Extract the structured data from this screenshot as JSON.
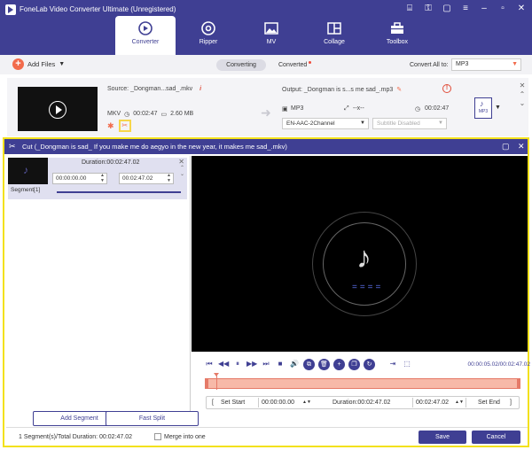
{
  "app": {
    "title": "FoneLab Video Converter Ultimate (Unregistered)",
    "window_icons": [
      "gift-icon",
      "key-icon",
      "chat-icon",
      "menu-icon",
      "minimize-icon",
      "maximize-icon",
      "close-icon"
    ],
    "window_glyphs": [
      "⌸",
      "⚿",
      "▢",
      "≡",
      "–",
      "▫",
      "✕"
    ]
  },
  "tabs": [
    {
      "label": "Converter",
      "icon": "converter-icon",
      "active": true
    },
    {
      "label": "Ripper",
      "icon": "disc-icon",
      "active": false
    },
    {
      "label": "MV",
      "icon": "image-icon",
      "active": false
    },
    {
      "label": "Collage",
      "icon": "collage-icon",
      "active": false
    },
    {
      "label": "Toolbox",
      "icon": "toolbox-icon",
      "active": false
    }
  ],
  "toolbar": {
    "add_files": "Add Files",
    "converting": "Converting",
    "converted": "Converted",
    "convert_all_label": "Convert All to:",
    "convert_all_value": "MP3"
  },
  "file": {
    "source": "Source: _Dongman...sad_.mkv",
    "container": "MKV",
    "duration": "00:02:47",
    "size": "2.60 MB",
    "output": "Output: _Dongman is s...s me sad_.mp3",
    "out_format": "MP3",
    "out_resolution": "--x--",
    "out_duration": "00:02:47",
    "audio_track": "EN-AAC-2Channel",
    "subtitle": "Subtitle Disabled",
    "format_badge": "MP3"
  },
  "cut": {
    "title": "Cut (_Dongman is sad_ If you make me do aegyo in the new year, it makes me sad_.mkv)",
    "segment": {
      "duration": "Duration:00:02:47.02",
      "start": "00:00:00.00",
      "end": "00:02:47.02",
      "label": "Segment[1]"
    },
    "add_segment": "Add Segment",
    "fast_split": "Fast Split",
    "playback_time": "00:00:05.02/00:02:47.02",
    "set_start_label": "Set Start",
    "start_time": "00:00:00.00",
    "duration_label": "Duration:00:02:47.02",
    "end_time": "00:02:47.02",
    "set_end_label": "Set End",
    "footer_info": "1 Segment(s)/Total Duration: 00:02:47.02",
    "merge_label": "Merge into one",
    "merge_checked": false,
    "save": "Save",
    "cancel": "Cancel"
  },
  "colors": {
    "brand": "#3f3f93",
    "accent": "#f26b4c",
    "highlight": "#f3e11c",
    "timeline": "#f7b9a8"
  }
}
